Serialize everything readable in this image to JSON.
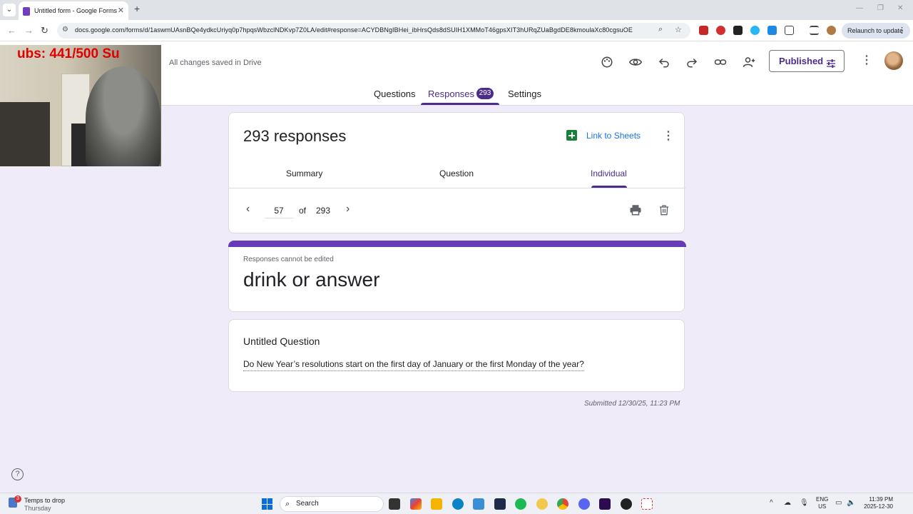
{
  "browser": {
    "tab_title": "Untitled form - Google Forms",
    "url": "docs.google.com/forms/d/1aswmUAsnBQe4ydkcUriyq0p7hpqsWbzclNDKvp7Z0LA/edit#response=ACYDBNgIBHei_ibHrsQds8dSUIH1XMMoT46gpsXIT3hURqZUaBgdDE8kmoulaXc80cgsuOE",
    "relaunch_label": "Relaunch to update"
  },
  "webcam": {
    "overlay_text": "ubs: 441/500  Su"
  },
  "header": {
    "save_status": "All changes saved in Drive",
    "published_label": "Published",
    "tabs": [
      {
        "label": "Questions"
      },
      {
        "label": "Responses",
        "badge": "293"
      },
      {
        "label": "Settings"
      }
    ]
  },
  "responses_card": {
    "count_title": "293 responses",
    "link_to_sheets": "Link to Sheets",
    "subtabs": [
      {
        "label": "Summary"
      },
      {
        "label": "Question"
      },
      {
        "label": "Individual"
      }
    ],
    "pager": {
      "current": "57",
      "of_label": "of",
      "total": "293"
    }
  },
  "form_card": {
    "notice": "Responses cannot be edited",
    "title": "drink or answer"
  },
  "question_card": {
    "question_title": "Untitled Question",
    "answer": "Do New Year’s resolutions start on the first day of January or the first Monday of the year?"
  },
  "submitted_text": "Submitted 12/30/25, 11:23 PM",
  "taskbar": {
    "weather_badge": "3",
    "weather_line1": "Temps to drop",
    "weather_line2": "Thursday",
    "search_label": "Search",
    "lang_line1": "ENG",
    "lang_line2": "US",
    "time": "11:39 PM",
    "date": "2025-12-30"
  },
  "colors": {
    "accent": "#4b2c89",
    "form_purple": "#673ab7",
    "page_bg": "#f0ebf8",
    "sheets_green": "#188038"
  }
}
